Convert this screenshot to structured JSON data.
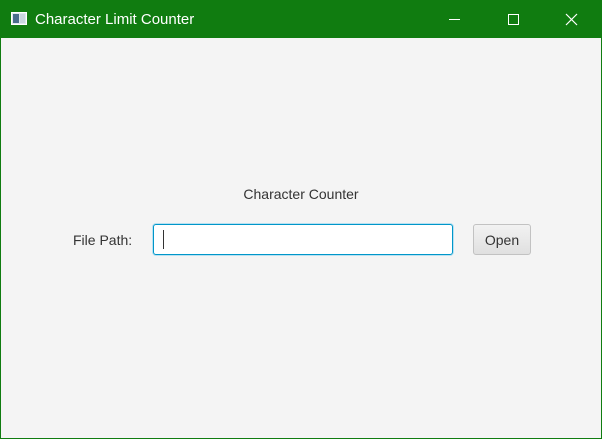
{
  "window": {
    "title": "Character Limit Counter",
    "accent_color": "#107c10",
    "controls": {
      "minimize_icon": "minimize-icon",
      "maximize_icon": "maximize-icon",
      "close_icon": "close-icon"
    }
  },
  "main": {
    "heading": "Character Counter",
    "file_path": {
      "label": "File Path:",
      "value": "",
      "placeholder": ""
    },
    "open_button_label": "Open"
  }
}
